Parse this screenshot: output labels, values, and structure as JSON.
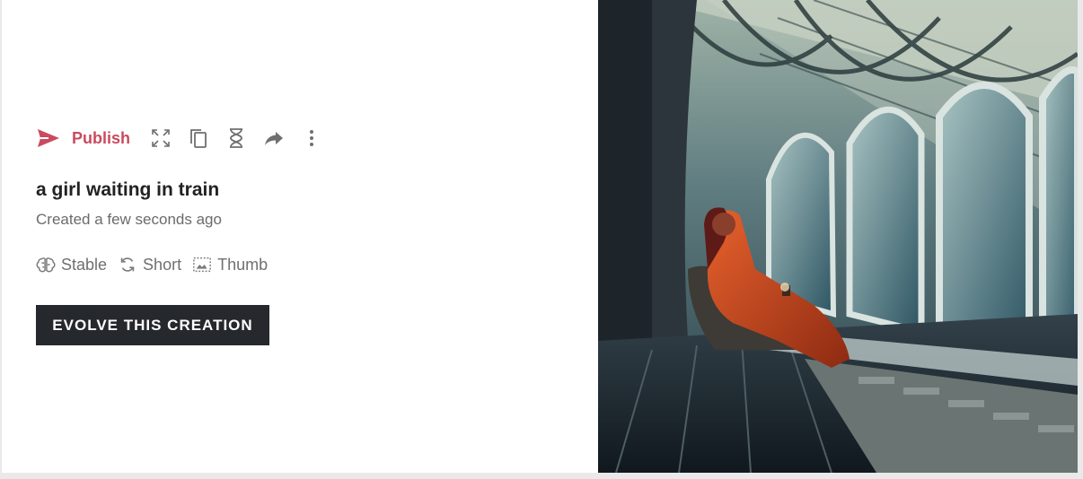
{
  "actions": {
    "publish_label": "Publish",
    "tools": [
      "expand-icon",
      "copy-icon",
      "hourglass-icon",
      "share-icon",
      "more-vertical-icon"
    ]
  },
  "creation": {
    "title": "a girl waiting in train",
    "created": "Created a few seconds ago",
    "tags": [
      "Stable",
      "Short",
      "Thumb"
    ]
  },
  "evolve_label": "EVOLVE THIS CREATION",
  "colors": {
    "publish": "#c94b5f",
    "button_bg": "#25282c",
    "text_muted": "#707070"
  }
}
